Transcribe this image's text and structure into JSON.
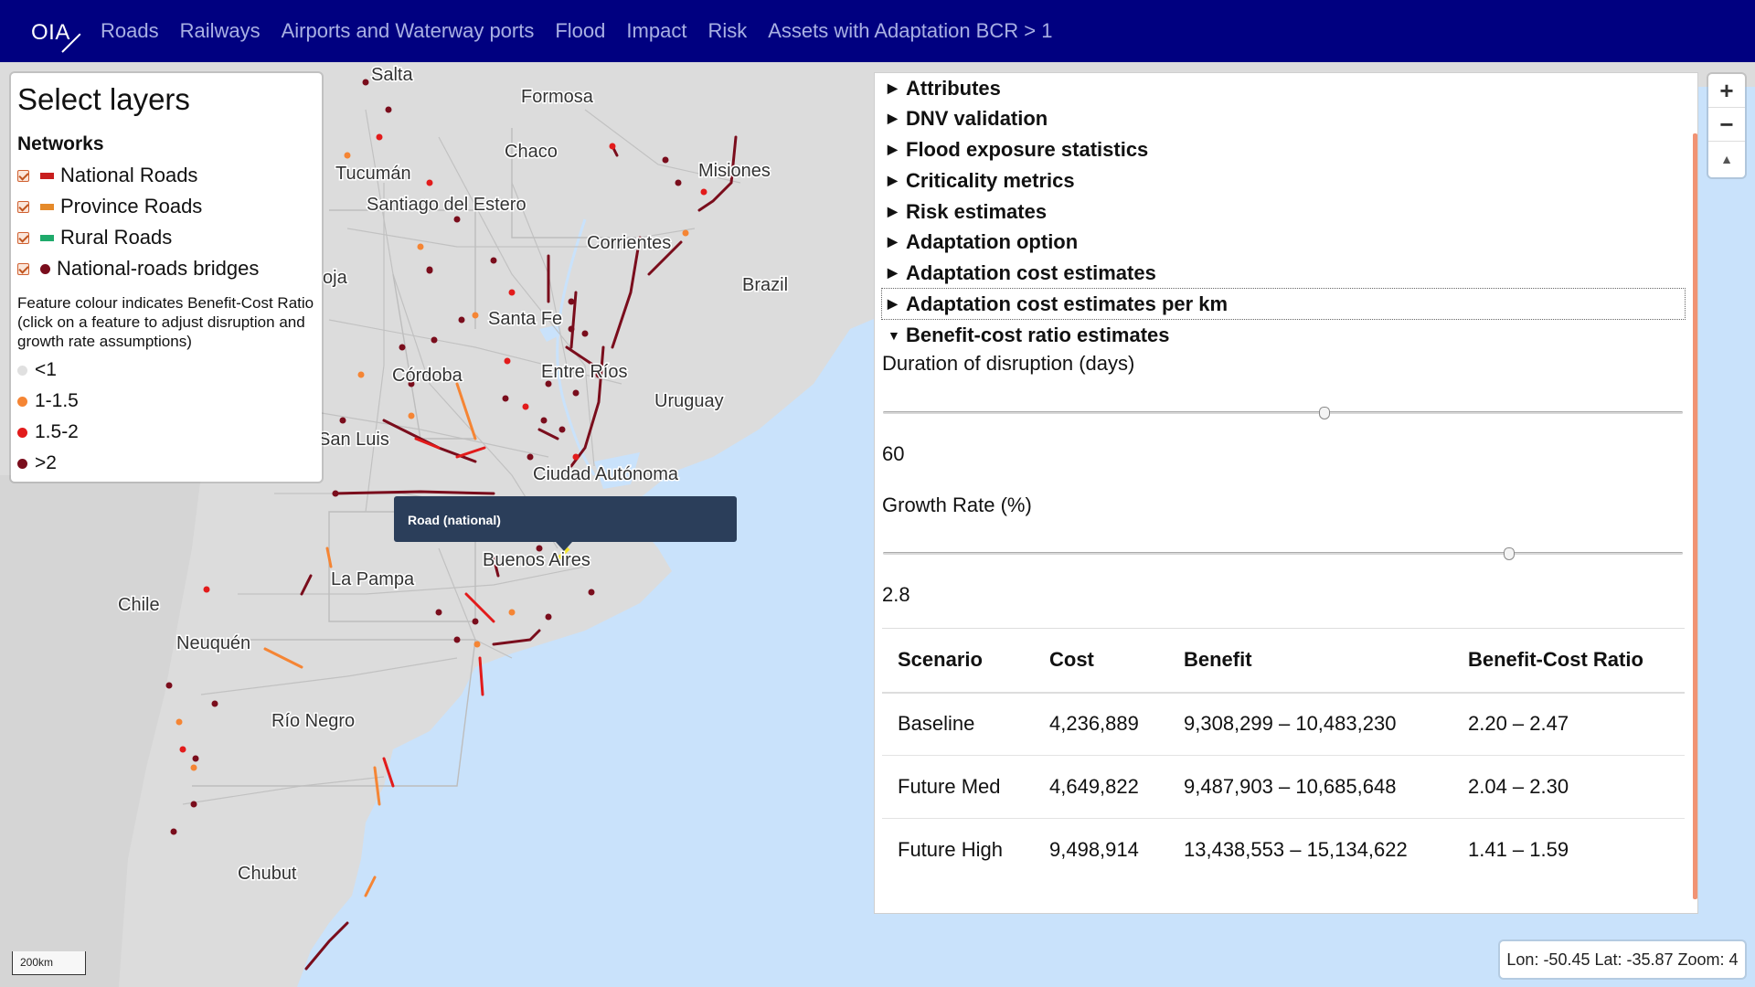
{
  "brand": {
    "text": "OIA"
  },
  "nav": {
    "items": [
      "Roads",
      "Railways",
      "Airports and Waterway ports",
      "Flood",
      "Impact",
      "Risk",
      "Assets with Adaptation BCR > 1"
    ]
  },
  "layers_panel": {
    "title": "Select layers",
    "networks_heading": "Networks",
    "networks": [
      {
        "label": "National Roads",
        "color": "#c81e1e",
        "shape": "bar",
        "checked": true
      },
      {
        "label": "Province Roads",
        "color": "#e58a2a",
        "shape": "bar",
        "checked": true
      },
      {
        "label": "Rural Roads",
        "color": "#1faa6b",
        "shape": "bar",
        "checked": true
      },
      {
        "label": "National-roads bridges",
        "color": "#7a0d1c",
        "shape": "dot",
        "checked": true
      }
    ],
    "feature_note": "Feature colour indicates Benefit-Cost Ratio (click on a feature to adjust disruption and growth rate assumptions)",
    "legend": [
      {
        "label": "<1",
        "color": "#e0e0e0"
      },
      {
        "label": "1-1.5",
        "color": "#f58534"
      },
      {
        "label": "1.5-2",
        "color": "#e21b1b"
      },
      {
        "label": ">2",
        "color": "#7a0d1c"
      }
    ]
  },
  "map_labels": {
    "salta": "Salta",
    "formosa": "Formosa",
    "chaco": "Chaco",
    "tucuman": "Tucumán",
    "misiones": "Misiones",
    "santiago": "Santiago del Estero",
    "corrientes": "Corrientes",
    "rioja": "oja",
    "brazil": "Brazil",
    "santa_fe": "Santa Fe",
    "cordoba": "Córdoba",
    "entre_rios": "Entre Ríos",
    "uruguay": "Uruguay",
    "san_luis": "San Luis",
    "caba": "Ciudad Autónoma",
    "buenos_aires": "Buenos Aires",
    "la_pampa": "La Pampa",
    "chile": "Chile",
    "neuquen": "Neuquén",
    "rio_negro": "Río Negro",
    "chubut": "Chubut"
  },
  "tooltip": {
    "text": "Road (national)"
  },
  "details": {
    "sections": [
      {
        "label": "Attributes",
        "expanded": false
      },
      {
        "label": "DNV validation",
        "expanded": false
      },
      {
        "label": "Flood exposure statistics",
        "expanded": false
      },
      {
        "label": "Criticality metrics",
        "expanded": false
      },
      {
        "label": "Risk estimates",
        "expanded": false
      },
      {
        "label": "Adaptation option",
        "expanded": false
      },
      {
        "label": "Adaptation cost estimates",
        "expanded": false
      },
      {
        "label": "Adaptation cost estimates per km",
        "expanded": false
      },
      {
        "label": "Benefit-cost ratio estimates",
        "expanded": true
      }
    ],
    "duration": {
      "label": "Duration of disruption (days)",
      "value": "60",
      "fraction": 0.552
    },
    "growth": {
      "label": "Growth Rate (%)",
      "value": "2.8",
      "fraction": 0.783
    },
    "table": {
      "headers": [
        "Scenario",
        "Cost",
        "Benefit",
        "Benefit-Cost Ratio"
      ],
      "rows": [
        [
          "Baseline",
          "4,236,889",
          "9,308,299 – 10,483,230",
          "2.20 – 2.47"
        ],
        [
          "Future Med",
          "4,649,822",
          "9,487,903 – 10,685,648",
          "2.04 – 2.30"
        ],
        [
          "Future High",
          "9,498,914",
          "13,438,553 – 15,134,622",
          "1.41 – 1.59"
        ]
      ]
    }
  },
  "map_controls": {
    "zoom_in": "+",
    "zoom_out": "−",
    "reset": "▲"
  },
  "coords": {
    "text": "Lon: -50.45 Lat: -35.87 Zoom: 4"
  },
  "scalebar": {
    "text": "200km"
  }
}
